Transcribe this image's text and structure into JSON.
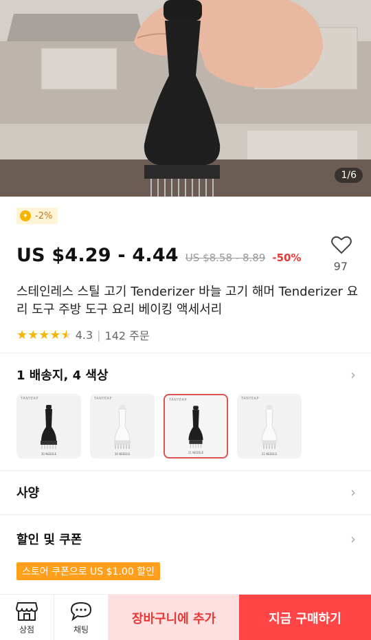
{
  "hero": {
    "counter": "1/6"
  },
  "promo": {
    "coin_discount": "-2%"
  },
  "price": {
    "current": "US $4.29 - 4.44",
    "original": "US $8.58 - 8.89",
    "discount": "-50%"
  },
  "wishlist": {
    "count": "97"
  },
  "product": {
    "title": "스테인레스 스틸 고기 Tenderizer 바늘 고기 해머 Tenderizer 요리 도구 주방 도구 요리 베이킹 액세서리",
    "rating": "4.3",
    "orders": "142 주문",
    "rating_stars": 4.3
  },
  "variants": {
    "title": "1 배송지, 4 색상",
    "items": [
      {
        "brand": "TANYEAP",
        "label": "30 NEEDLE",
        "color": "black",
        "selected": false
      },
      {
        "brand": "TANYEAP",
        "label": "30 NEEDLE",
        "color": "white",
        "selected": false
      },
      {
        "brand": "TANYEAP",
        "label": "21 NEEDLE",
        "color": "black",
        "selected": true
      },
      {
        "brand": "TANYEAP",
        "label": "21 NEEDLE",
        "color": "white",
        "selected": false
      }
    ]
  },
  "specs": {
    "title": "사양"
  },
  "coupons": {
    "title": "할인 및 쿠폰",
    "store_coupon": "스토어 쿠폰으로 US $1.00 할인"
  },
  "bottom": {
    "store_label": "상점",
    "chat_label": "채팅",
    "cart_label": "장바구니에 추가",
    "buy_label": "지금 구매하기"
  },
  "colors": {
    "accent_red": "#ff4545",
    "price_red": "#e53935",
    "star": "#f7b500",
    "coupon_orange": "#ff9f1c"
  }
}
